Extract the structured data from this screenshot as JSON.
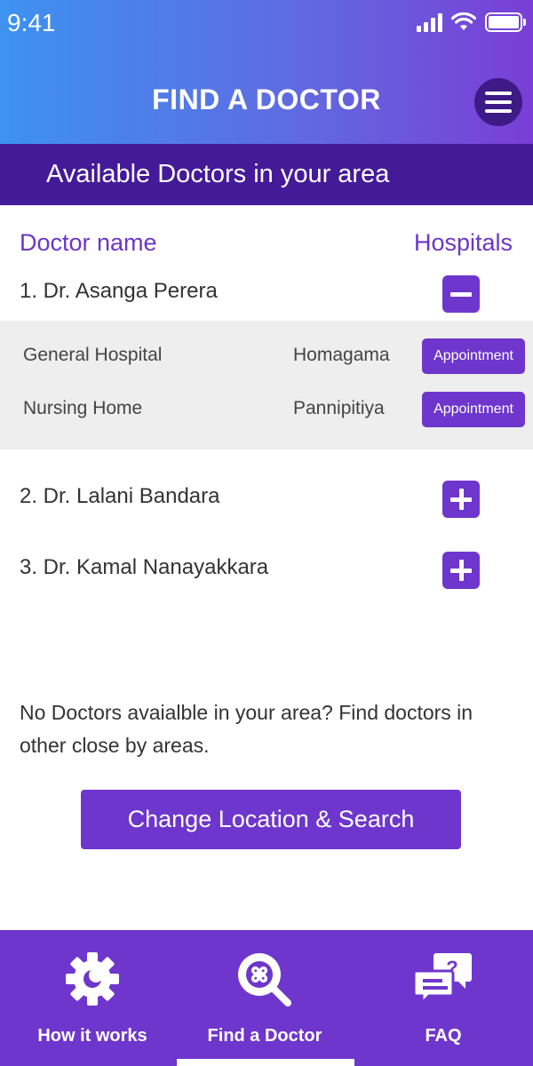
{
  "status_bar": {
    "time": "9:41",
    "signal_icon": "signal-icon",
    "wifi_icon": "wifi-icon",
    "battery_icon": "battery-icon"
  },
  "header": {
    "title": "FIND A DOCTOR",
    "menu_icon": "hamburger-menu-icon"
  },
  "banner": {
    "text": "Available Doctors in your area"
  },
  "columns": {
    "doctor": "Doctor name",
    "hospitals": "Hospitals"
  },
  "doctors": [
    {
      "name": "1. Dr. Asanga Perera",
      "expanded": true,
      "toggle_icon": "minus-icon",
      "hospitals": [
        {
          "name": "General Hospital",
          "location": "Homagama",
          "action": "Appointment"
        },
        {
          "name": "Nursing Home",
          "location": "Pannipitiya",
          "action": "Appointment"
        }
      ]
    },
    {
      "name": "2. Dr. Lalani Bandara",
      "expanded": false,
      "toggle_icon": "plus-icon"
    },
    {
      "name": "3. Dr. Kamal Nanayakkara",
      "expanded": false,
      "toggle_icon": "plus-icon"
    }
  ],
  "note": "No Doctors avaialble in your area? Find doctors in other close by areas.",
  "cta": {
    "label": "Change Location & Search"
  },
  "bottom_nav": [
    {
      "label": "How it works",
      "icon": "gear-icon",
      "active": false
    },
    {
      "label": "Find a Doctor",
      "icon": "doctor-search-icon",
      "active": true
    },
    {
      "label": "FAQ",
      "icon": "faq-chat-icon",
      "active": false
    }
  ],
  "colors": {
    "accent": "#6e36cc",
    "banner": "#451a99",
    "gradient_start": "#3d92f0",
    "gradient_end": "#7a3ed6",
    "panel_bg": "#eeeeee"
  }
}
